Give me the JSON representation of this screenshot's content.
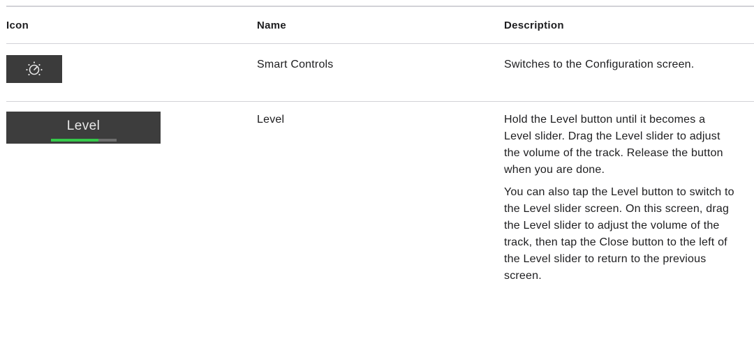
{
  "table": {
    "headers": {
      "icon": "Icon",
      "name": "Name",
      "description": "Description"
    },
    "rows": [
      {
        "icon": "smart-controls-knob-icon",
        "name": "Smart Controls",
        "description": [
          "Switches to the Configuration screen."
        ]
      },
      {
        "icon": "level-button-icon",
        "icon_label": "Level",
        "level_fraction": 0.72,
        "name": "Level",
        "description": [
          "Hold the Level button until it becomes a Level slider. Drag the Level slider to adjust the volume of the track. Release the button when you are done.",
          "You can also tap the Level button to switch to the Level slider screen. On this screen, drag the Level slider to adjust the volume of the track, then tap the Close button to the left of the Level slider to return to the previous screen."
        ]
      }
    ]
  },
  "colors": {
    "icon_background": "#3b3b3b",
    "level_fill": "#35c94a",
    "divider": "#d2d2d7"
  }
}
